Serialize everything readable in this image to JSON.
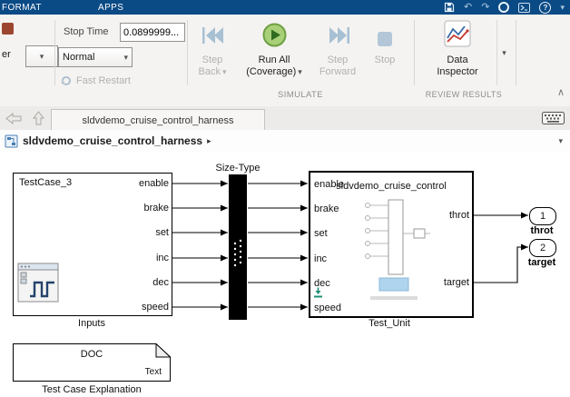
{
  "icons": {
    "dropdown": "▾",
    "collapse_ribbon": "∧",
    "undo": "↶",
    "redo": "↷",
    "help": "?",
    "breadcrumb_arrow": "▸"
  },
  "titlebar": {
    "tabs": [
      "FORMAT",
      "APPS"
    ]
  },
  "toolbar": {
    "partial_label": "er",
    "stop_time": {
      "label": "Stop Time",
      "value": "0.0899999..."
    },
    "sim_mode": {
      "value": "Normal"
    },
    "fast_restart": {
      "label": "Fast Restart"
    },
    "buttons": {
      "step_back": {
        "line1": "Step",
        "line2": "Back"
      },
      "run_all": {
        "line1": "Run All",
        "line2": "(Coverage)"
      },
      "step_forward": {
        "line1": "Step",
        "line2": "Forward"
      },
      "stop": {
        "label": "Stop"
      },
      "data_inspector": {
        "line1": "Data",
        "line2": "Inspector"
      }
    },
    "sections": {
      "simulate": "SIMULATE",
      "review_results": "REVIEW RESULTS"
    }
  },
  "tabbar": {
    "active_tab": "sldvdemo_cruise_control_harness"
  },
  "breadcrumb": {
    "path": "sldvdemo_cruise_control_harness"
  },
  "canvas": {
    "inputs": {
      "title": "TestCase_3",
      "caption": "Inputs",
      "ports": [
        "enable",
        "brake",
        "set",
        "inc",
        "dec",
        "speed"
      ]
    },
    "size_type": {
      "caption": "Size-Type"
    },
    "test_unit": {
      "title": "sldvdemo_cruise_control",
      "caption": "Test_Unit",
      "in_ports": [
        "enable",
        "brake",
        "set",
        "inc",
        "dec",
        "speed"
      ],
      "out_ports": [
        "throt",
        "target"
      ]
    },
    "outports": [
      {
        "num": "1",
        "label": "throt"
      },
      {
        "num": "2",
        "label": "target"
      }
    ],
    "doc": {
      "title": "DOC",
      "corner": "Text",
      "caption": "Test Case Explanation"
    }
  }
}
